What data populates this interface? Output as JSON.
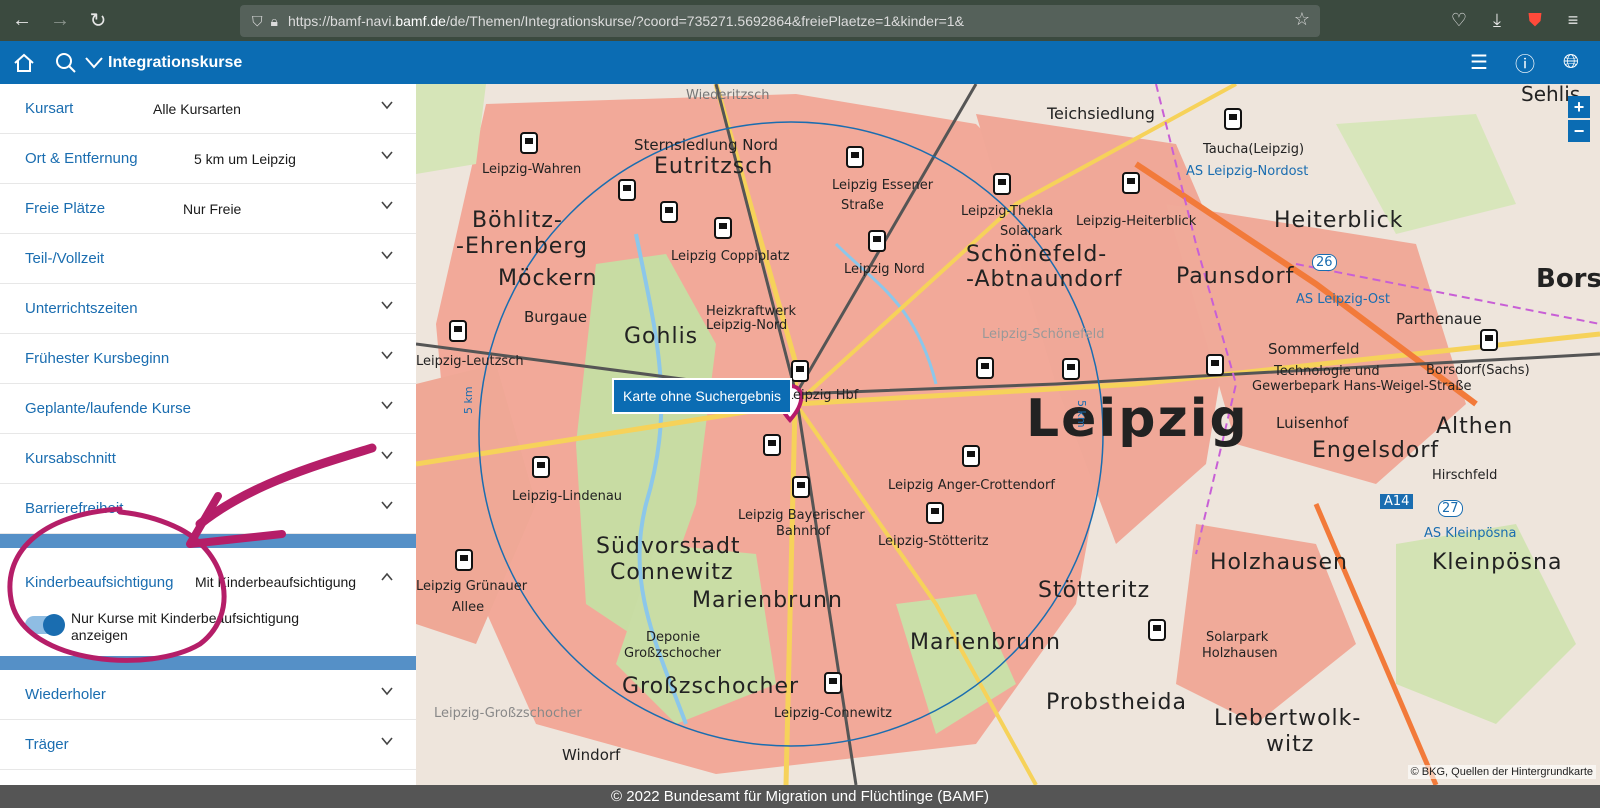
{
  "browser": {
    "url_prefix": "https://bamf-navi.",
    "url_host": "bamf.de",
    "url_path": "/de/Themen/Integrationskurse/?coord=735271.5692864&freiePlaetze=1&kinder=1&"
  },
  "header": {
    "title": "Integrationskurse"
  },
  "filters": [
    {
      "label": "Kursart",
      "value": "Alle Kursarten"
    },
    {
      "label": "Ort & Entfernung",
      "value": "5 km um Leipzig"
    },
    {
      "label": "Freie Plätze",
      "value": "Nur Freie"
    },
    {
      "label": "Teil-/Vollzeit",
      "value": ""
    },
    {
      "label": "Unterrichtszeiten",
      "value": ""
    },
    {
      "label": "Frühester Kursbeginn",
      "value": ""
    },
    {
      "label": "Geplante/laufende Kurse",
      "value": ""
    },
    {
      "label": "Kursabschnitt",
      "value": ""
    },
    {
      "label": "Barrierefreiheit",
      "value": ""
    }
  ],
  "expanded_filter": {
    "label": "Kinderbeaufsichtigung",
    "value": "Mit Kinderbeaufsichtigung",
    "toggle_text": "Nur Kurse mit Kinderbeaufsichtigung anzeigen",
    "toggle_on": true
  },
  "filters_after": [
    {
      "label": "Wiederholer",
      "value": ""
    },
    {
      "label": "Träger",
      "value": ""
    }
  ],
  "map": {
    "no_result_label": "Karte ohne Suchergebnis",
    "radius_label": "5 km",
    "zoom_in": "+",
    "zoom_out": "−",
    "attribution": "© BKG, Quellen der Hintergrundkarte",
    "places": {
      "leipzig": "Leipzig",
      "eutritzsch": "Eutritzsch",
      "sternsiedlung": "Sternsiedlung Nord",
      "boehlitz": "Böhlitz-",
      "ehrenberg": "-Ehrenberg",
      "moeckern": "Möckern",
      "gohlis": "Gohlis",
      "schoenefeld": "Schönefeld-",
      "abtnaundorf": "-Abtnaundorf",
      "paunsdorf": "Paunsdorf",
      "heiterblick": "Heiterblick",
      "teichsiedlung": "Teichsiedlung",
      "suedvorstadt": "Südvorstadt",
      "connewitz": "Connewitz",
      "marienbrunn": "Marienbrunn",
      "marienbrunn2": "Marienbrunn",
      "grosszschocher": "Großzschocher",
      "stoetteritz": "Stötteritz",
      "probstheida": "Probstheida",
      "holzhausen": "Holzhausen",
      "engelsdorf": "Engelsdorf",
      "althen": "Althen",
      "liebertwolkwitz": "Liebertwolk-",
      "witz": "witz",
      "kleinpoesna": "Kleinpösna",
      "sommerfeld": "Sommerfeld",
      "wiederitzsch": "Wiederitzsch",
      "burgaue": "Burgaue",
      "leipzig_hbf": "Leipzig Hbf",
      "leipzig_wahren": "Leipzig-Wahren",
      "leipzig_leutzsch": "Leipzig-Leutzsch",
      "leipzig_lindenau": "Leipzig-Lindenau",
      "leipzig_gruenauer": "Leipzig Grünauer",
      "allee": "Allee",
      "leipzig_coppiplatz": "Leipzig Coppiplatz",
      "leipzig_essener": "Leipzig Essener",
      "strasse": "Straße",
      "leipzig_nord": "Leipzig Nord",
      "leipzig_thekla": "Leipzig-Thekla",
      "leipzig_heiterblick": "Leipzig-Heiterblick",
      "taucha": "Taucha(Leipzig)",
      "as_nordost": "AS Leipzig-Nordost",
      "as_ost": "AS Leipzig-Ost",
      "as_kleinpoesna": "AS Kleinpösna",
      "heizkraftwerk": "Heizkraftwerk",
      "leipzig_nord2": "Leipzig-Nord",
      "leipzig_bayerischer": "Leipzig Bayerischer",
      "bahnhof": "Bahnhof",
      "leipzig_anger": "Leipzig Anger-Crottendorf",
      "leipzig_stoetteritz": "Leipzig-Stötteritz",
      "leipzig_connewitz": "Leipzig-Connewitz",
      "leipzig_grosszschocher": "Leipzig-Großzschocher",
      "leipzig_schoenefeld": "Leipzig-Schönefeld",
      "deponie": "Deponie",
      "deponie_gz": "Großzschocher",
      "windorf": "Windorf",
      "solarpark_holzhausen": "Solarpark",
      "holzhausen2": "Holzhausen",
      "solarpark": "Solarpark",
      "technologie": "Technologie und",
      "gewerbepark": "Gewerbepark Hans-Weigel-Straße",
      "borsdorf": "Borsdorf(Sachs)",
      "luisenhof": "Luisenhof",
      "hirschfeld": "Hirschfeld",
      "parthenaue": "Parthenaue",
      "taucha_sehlis": "Sehlis",
      "bors": "Bors",
      "a14": "A14",
      "r26": "26",
      "r27": "27"
    }
  },
  "footer": {
    "text": "© 2022 Bundesamt für Migration und Flüchtlinge (BAMF)"
  }
}
